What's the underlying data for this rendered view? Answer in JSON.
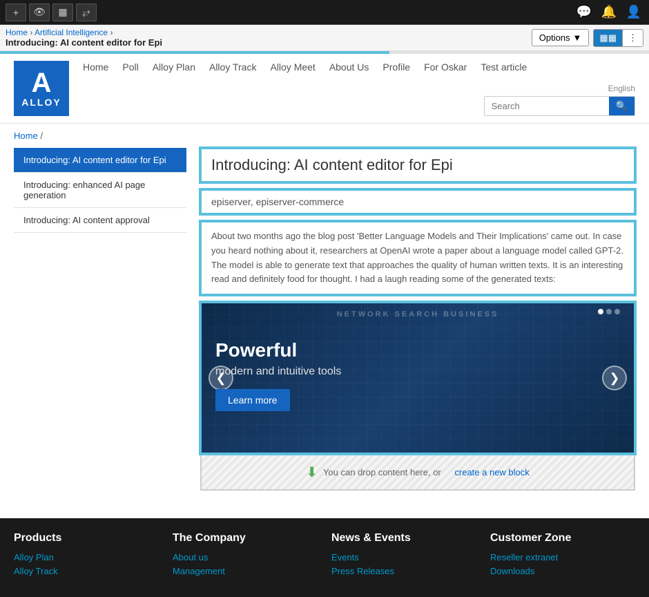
{
  "toolbar": {
    "buttons": [
      {
        "id": "plus",
        "icon": "+",
        "label": "Add"
      },
      {
        "id": "preview",
        "icon": "👁",
        "label": "Preview"
      },
      {
        "id": "frames",
        "icon": "⊞",
        "label": "Frames"
      },
      {
        "id": "resize",
        "icon": "⤢",
        "label": "Resize"
      }
    ],
    "right_icons": [
      {
        "id": "chat",
        "icon": "💬",
        "label": "Chat"
      },
      {
        "id": "bell",
        "icon": "🔔",
        "label": "Notifications"
      },
      {
        "id": "user",
        "icon": "👤",
        "label": "User"
      }
    ],
    "options_label": "Options",
    "chevron": "▾",
    "view_grid_icon": "⊞",
    "view_list_icon": "⋮"
  },
  "breadcrumb_bar": {
    "home": "Home",
    "separator": " › ",
    "section": "Artificial Intelligence",
    "separator2": " › ",
    "page": "Introducing: AI content editor for Epi"
  },
  "site": {
    "logo_letter": "A",
    "logo_name": "ALLOY",
    "nav_items": [
      {
        "id": "home",
        "label": "Home"
      },
      {
        "id": "poll",
        "label": "Poll"
      },
      {
        "id": "alloy-plan",
        "label": "Alloy Plan"
      },
      {
        "id": "alloy-track",
        "label": "Alloy Track"
      },
      {
        "id": "alloy-meet",
        "label": "Alloy Meet"
      },
      {
        "id": "about-us",
        "label": "About Us"
      },
      {
        "id": "profile",
        "label": "Profile"
      },
      {
        "id": "for-oskar",
        "label": "For Oskar"
      },
      {
        "id": "test-article",
        "label": "Test article"
      }
    ],
    "language": "English",
    "search_placeholder": "Search",
    "search_icon": "🔍"
  },
  "page_breadcrumb": {
    "home": "Home",
    "separator": "/"
  },
  "sidebar": {
    "items": [
      {
        "id": "item1",
        "label": "Introducing: AI content editor for Epi",
        "active": true
      },
      {
        "id": "item2",
        "label": "Introducing: enhanced AI page generation",
        "active": false
      },
      {
        "id": "item3",
        "label": "Introducing: AI content approval",
        "active": false
      }
    ]
  },
  "article": {
    "title": "Introducing: AI content editor for Epi",
    "tags": "episerver, episerver-commerce",
    "body": "About two months ago the blog post 'Better Language Models and Their Implications' came out. In case you heard nothing about it, researchers at OpenAI wrote a paper about a language model called GPT-2. The model is able to generate text that approaches the quality of human written texts. It is an interesting read and definitely food for thought. I had a laugh reading some of the generated texts:"
  },
  "carousel": {
    "header_text": "NETWORK SEARCH BUSINESS",
    "title": "Powerful",
    "subtitle": "modern and intuitive tools",
    "btn_label": "Learn more",
    "prev_icon": "❮",
    "next_icon": "❯",
    "dots": [
      true,
      false,
      false
    ]
  },
  "drop_zone": {
    "icon": "⬇",
    "text": "You can drop content here, or",
    "link_text": "create a new block"
  },
  "footer": {
    "columns": [
      {
        "heading": "Products",
        "links": [
          {
            "label": "Alloy Plan",
            "href": "#"
          },
          {
            "label": "Alloy Track",
            "href": "#"
          }
        ]
      },
      {
        "heading": "The Company",
        "links": [
          {
            "label": "About us",
            "href": "#"
          },
          {
            "label": "Management",
            "href": "#"
          }
        ]
      },
      {
        "heading": "News & Events",
        "links": [
          {
            "label": "Events",
            "href": "#"
          },
          {
            "label": "Press Releases",
            "href": "#"
          }
        ]
      },
      {
        "heading": "Customer Zone",
        "links": [
          {
            "label": "Reseller extranet",
            "href": "#"
          },
          {
            "label": "Downloads",
            "href": "#"
          }
        ]
      }
    ]
  }
}
